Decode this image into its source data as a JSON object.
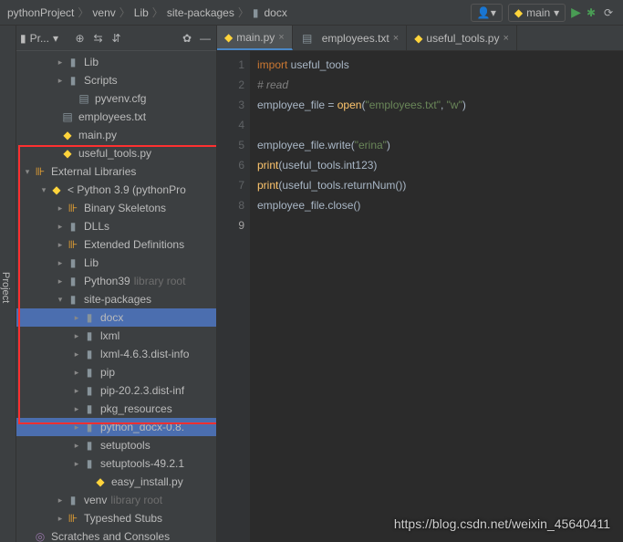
{
  "breadcrumbs": [
    "pythonProject",
    "venv",
    "Lib",
    "site-packages",
    "docx"
  ],
  "run_config": "main",
  "panel_title": "Pr...",
  "sidebar_tab": "Project",
  "tree": {
    "lib": "Lib",
    "scripts": "Scripts",
    "pyvenv": "pyvenv.cfg",
    "employees_txt": "employees.txt",
    "main_py": "main.py",
    "useful_tools": "useful_tools.py",
    "external": "External Libraries",
    "python39": "< Python 3.9 (pythonPro",
    "binary_sk": "Binary Skeletons",
    "dlls": "DLLs",
    "ext_def": "Extended Definitions",
    "lib2": "Lib",
    "python39_dir": "Python39",
    "lib_root": "library root",
    "site_packages": "site-packages",
    "docx": "docx",
    "lxml": "lxml",
    "lxml_dist": "lxml-4.6.3.dist-info",
    "pip": "pip",
    "pip_dist": "pip-20.2.3.dist-inf",
    "pkg_res": "pkg_resources",
    "python_docx": "python_docx-0.8.",
    "setuptools": "setuptools",
    "setuptools_dist": "setuptools-49.2.1",
    "easy_install": "easy_install.py",
    "venv2": "venv",
    "typeshed": "Typeshed Stubs",
    "scratches": "Scratches and Consoles"
  },
  "tabs": [
    {
      "name": "main.py",
      "icon": "py",
      "active": true
    },
    {
      "name": "employees.txt",
      "icon": "txt",
      "active": false
    },
    {
      "name": "useful_tools.py",
      "icon": "py",
      "active": false
    }
  ],
  "gutter": [
    "1",
    "2",
    "3",
    "4",
    "5",
    "6",
    "7",
    "8",
    "9"
  ],
  "current_line": "9",
  "code": {
    "l1_kw": "import",
    "l1_mod": " useful_tools",
    "l2": "# read",
    "l3_a": "employee_file = ",
    "l3_fn": "open",
    "l3_b": "(",
    "l3_s1": "\"employees.txt\"",
    "l3_c": ", ",
    "l3_s2": "\"w\"",
    "l3_d": ")",
    "l5_a": "employee_file.write(",
    "l5_s": "\"erina\"",
    "l5_b": ")",
    "l6_kw": "print",
    "l6_a": "(useful_tools.int123)",
    "l7_kw": "print",
    "l7_a": "(useful_tools.returnNum())",
    "l8": "employee_file.close()"
  },
  "watermark": "https://blog.csdn.net/weixin_45640411"
}
